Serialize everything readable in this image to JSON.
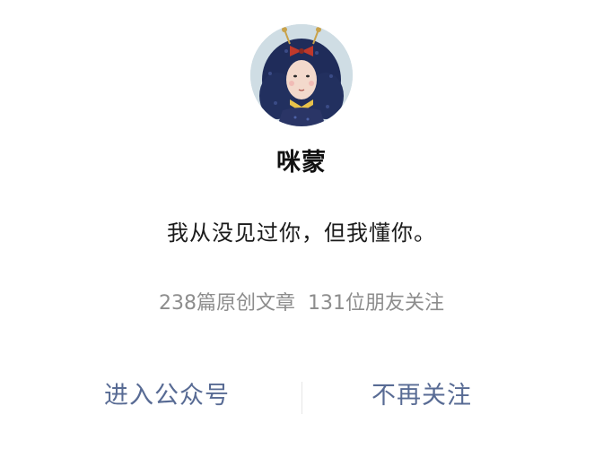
{
  "profile": {
    "name": "咪蒙",
    "bio": "我从没见过你，但我懂你。",
    "articles": "238篇原创文章",
    "followers": "131位朋友关注"
  },
  "actions": {
    "enter": "进入公众号",
    "unfollow": "不再关注"
  },
  "colors": {
    "link": "#586b94",
    "stats": "#8d8d8d",
    "text": "#1a1a1a"
  }
}
